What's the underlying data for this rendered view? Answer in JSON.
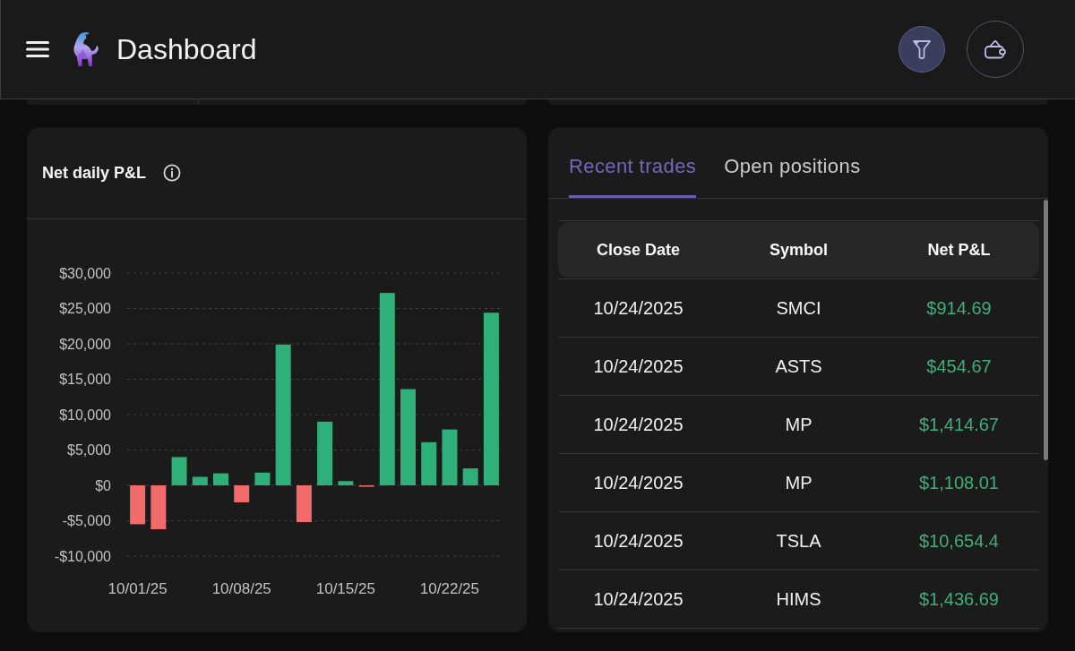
{
  "header": {
    "title": "Dashboard"
  },
  "pnl_card": {
    "title": "Net daily P&L",
    "chart_data": {
      "type": "bar",
      "grid": true,
      "categories": [
        "10/01/25",
        null,
        null,
        null,
        null,
        "10/08/25",
        null,
        null,
        null,
        null,
        "10/15/25",
        null,
        null,
        null,
        null,
        "10/22/25",
        null,
        null
      ],
      "values": [
        -5500,
        -6200,
        4000,
        1200,
        1700,
        -2400,
        1800,
        19900,
        -5200,
        9000,
        600,
        -200,
        27200,
        13600,
        6100,
        7900,
        2400,
        24400
      ],
      "ylim": [
        -10000,
        30000
      ],
      "yticks": [
        {
          "value": 30000,
          "label": "$30,000"
        },
        {
          "value": 25000,
          "label": "$25,000"
        },
        {
          "value": 20000,
          "label": "$20,000"
        },
        {
          "value": 15000,
          "label": "$15,000"
        },
        {
          "value": 10000,
          "label": "$10,000"
        },
        {
          "value": 5000,
          "label": "$5,000"
        },
        {
          "value": 0,
          "label": "$0"
        },
        {
          "value": -5000,
          "label": "-$5,000"
        },
        {
          "value": -10000,
          "label": "-$10,000"
        }
      ]
    }
  },
  "trades_card": {
    "tabs": [
      {
        "label": "Recent trades",
        "selected": true
      },
      {
        "label": "Open positions",
        "selected": false
      }
    ],
    "table": {
      "columns": [
        "Close Date",
        "Symbol",
        "Net P&L"
      ],
      "rows": [
        [
          "10/24/2025",
          "SMCI",
          "$914.69"
        ],
        [
          "10/24/2025",
          "ASTS",
          "$454.67"
        ],
        [
          "10/24/2025",
          "MP",
          "$1,414.67"
        ],
        [
          "10/24/2025",
          "MP",
          "$1,108.01"
        ],
        [
          "10/24/2025",
          "TSLA",
          "$10,654.4"
        ],
        [
          "10/24/2025",
          "HIMS",
          "$1,436.69"
        ]
      ]
    }
  }
}
